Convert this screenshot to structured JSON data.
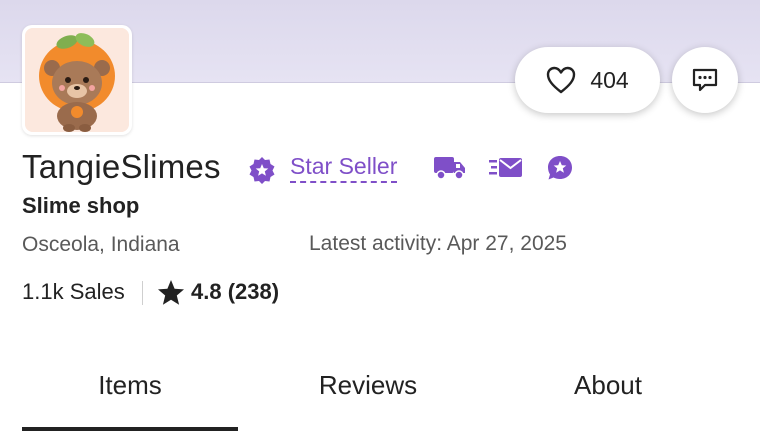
{
  "shop": {
    "name": "TangieSlimes",
    "star_seller_label": "Star Seller",
    "tagline": "Slime shop",
    "location": "Osceola, Indiana",
    "latest_activity": "Latest activity: Apr 27, 2025",
    "sales": "1.1k Sales",
    "rating": "4.8 (238)"
  },
  "favorites": {
    "count": "404"
  },
  "tabs": [
    {
      "label": "Items",
      "selected": true
    },
    {
      "label": "Reviews",
      "selected": false
    },
    {
      "label": "About",
      "selected": false
    }
  ],
  "icons": {
    "favorite": "heart-icon",
    "message": "chat-bubble-icon",
    "star_badge": "star-seller-badge-icon",
    "shipping": "shipping-truck-icon",
    "messages": "fast-message-icon",
    "reviews_badge": "review-badge-icon",
    "rating": "star-icon"
  },
  "colors": {
    "accent": "#7f4fc8",
    "banner": "#e1def0",
    "text": "#222222",
    "muted": "#595959"
  }
}
